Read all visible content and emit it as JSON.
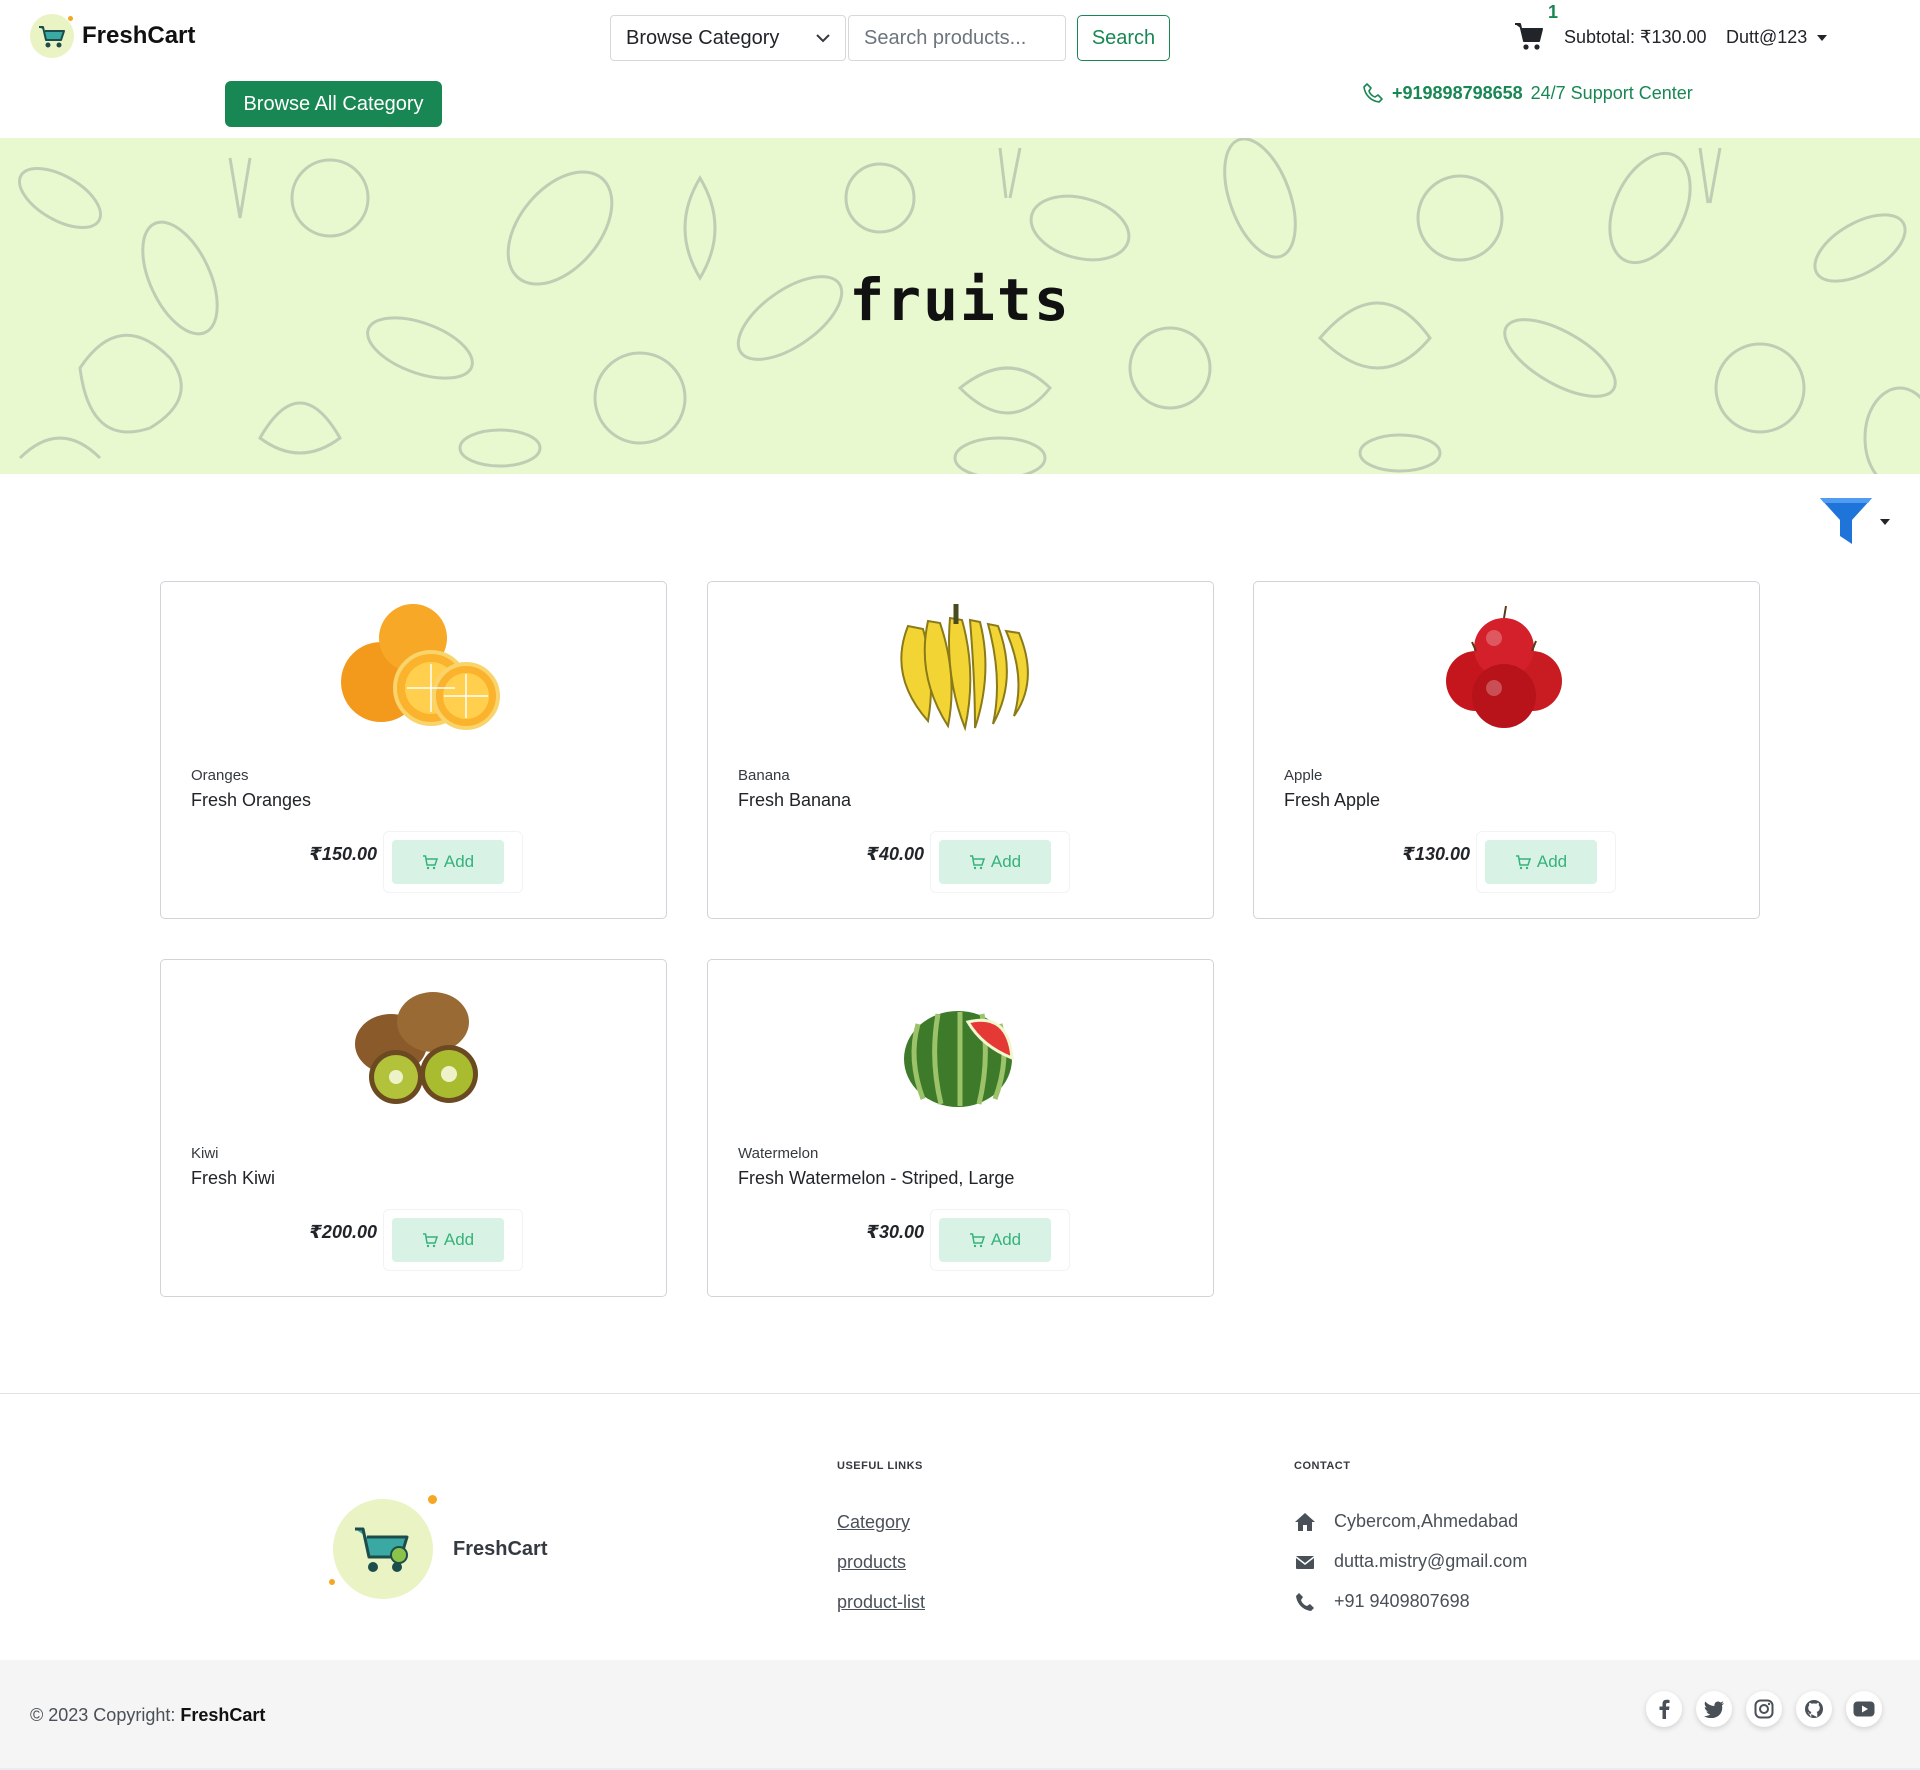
{
  "header": {
    "brand": "FreshCart",
    "category_select": "Browse Category",
    "search_placeholder": "Search products...",
    "search_button": "Search",
    "cart_count": "1",
    "subtotal": "Subtotal: ₹130.00",
    "user": "Dutt@123",
    "browse_all": "Browse All Category",
    "support_phone": "+919898798658",
    "support_label": "24/7 Support Center"
  },
  "banner": {
    "title": "fruits"
  },
  "products": [
    {
      "category": "Oranges",
      "name": "Fresh Oranges",
      "price": "₹150.00",
      "add": "Add"
    },
    {
      "category": "Banana",
      "name": "Fresh Banana",
      "price": "₹40.00",
      "add": "Add"
    },
    {
      "category": "Apple",
      "name": "Fresh Apple",
      "price": "₹130.00",
      "add": "Add"
    },
    {
      "category": "Kiwi",
      "name": "Fresh Kiwi",
      "price": "₹200.00",
      "add": "Add"
    },
    {
      "category": "Watermelon",
      "name": "Fresh Watermelon - Striped, Large",
      "price": "₹30.00",
      "add": "Add"
    }
  ],
  "footer": {
    "brand": "FreshCart",
    "useful_links_heading": "USEFUL LINKS",
    "links": [
      "Category",
      "products",
      "product-list"
    ],
    "contact_heading": "CONTACT",
    "address": "Cybercom,Ahmedabad",
    "email": "dutta.mistry@gmail.com",
    "phone": "+91 9409807698",
    "copyright_prefix": "© 2023 Copyright:",
    "copyright_brand": "FreshCart"
  },
  "colors": {
    "accent": "#198754",
    "banner_bg": "#e8f8cf",
    "add_bg": "#d8f3e6"
  }
}
